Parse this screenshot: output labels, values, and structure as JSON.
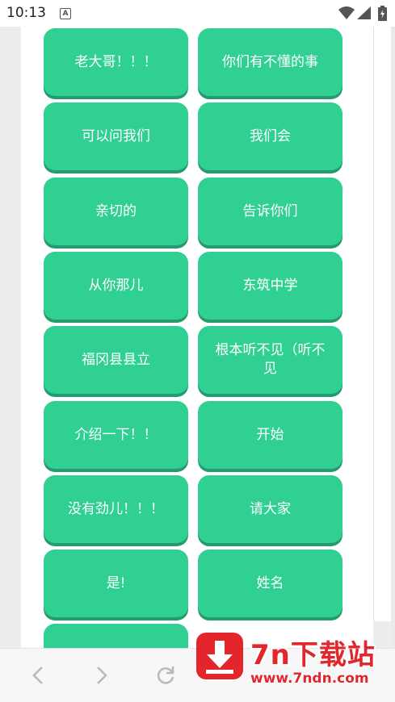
{
  "status_bar": {
    "time": "10:13",
    "notification_icon": "a-icon",
    "wifi_icon": "wifi-icon",
    "signal_icon": "signal-icon",
    "battery_icon": "battery-icon"
  },
  "phrase_buttons": [
    "老大哥！！！",
    "你们有不懂的事",
    "可以问我们",
    "我们会",
    "亲切的",
    "告诉你们",
    "从你那儿",
    "东筑中学",
    "福冈县县立",
    "根本听不见（听不见",
    "介绍一下！！",
    "开始",
    "没有劲儿！！！",
    "请大家",
    "是!",
    "姓名",
    ""
  ],
  "bottom_nav": {
    "back_icon": "chevron-left-icon",
    "forward_icon": "chevron-right-icon",
    "reload_icon": "reload-icon"
  },
  "watermark": {
    "title": "7n下载站",
    "url": "www.7ndn.com",
    "icon": "download-arrow-icon"
  },
  "colors": {
    "button": "#2fd091",
    "button_shadow": "#259c70",
    "watermark": "#e3262b"
  }
}
